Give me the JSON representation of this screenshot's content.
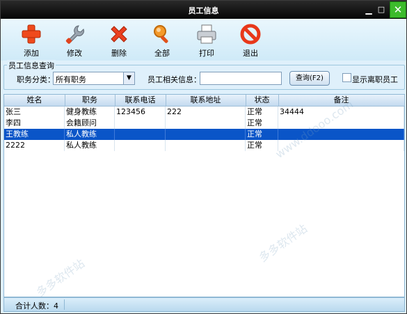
{
  "window": {
    "title": "员工信息"
  },
  "toolbar": {
    "items": [
      {
        "label": "添加",
        "icon": "plus-icon"
      },
      {
        "label": "修改",
        "icon": "wrench-icon"
      },
      {
        "label": "删除",
        "icon": "x-icon"
      },
      {
        "label": "全部",
        "icon": "magnifier-icon"
      },
      {
        "label": "打印",
        "icon": "printer-icon"
      },
      {
        "label": "退出",
        "icon": "no-entry-icon"
      }
    ]
  },
  "search": {
    "group_title": "员工信息查询",
    "category_label": "职务分类：",
    "category_value": "所有职务",
    "info_label": "员工相关信息：",
    "info_value": "",
    "query_button": "查询(F2)",
    "show_resigned_label": "显示离职员工"
  },
  "table": {
    "columns": [
      "姓名",
      "职务",
      "联系电话",
      "联系地址",
      "状态",
      "备注"
    ],
    "rows": [
      [
        "张三",
        "健身教练",
        "123456",
        "222",
        "正常",
        "34444"
      ],
      [
        "李四",
        "会籍顾问",
        "",
        "",
        "正常",
        ""
      ],
      [
        "王教练",
        "私人教练",
        "",
        "",
        "正常",
        ""
      ],
      [
        "2222",
        "私人教练",
        "",
        "",
        "正常",
        ""
      ]
    ]
  },
  "status": {
    "total": "合计人数：4"
  },
  "watermark": {
    "text": "多多软件站",
    "domain": "www.ddooo.com"
  },
  "colors": {
    "selection": "#0a55c8",
    "close_button": "#3dbb2c",
    "background": "#dff0fb"
  }
}
